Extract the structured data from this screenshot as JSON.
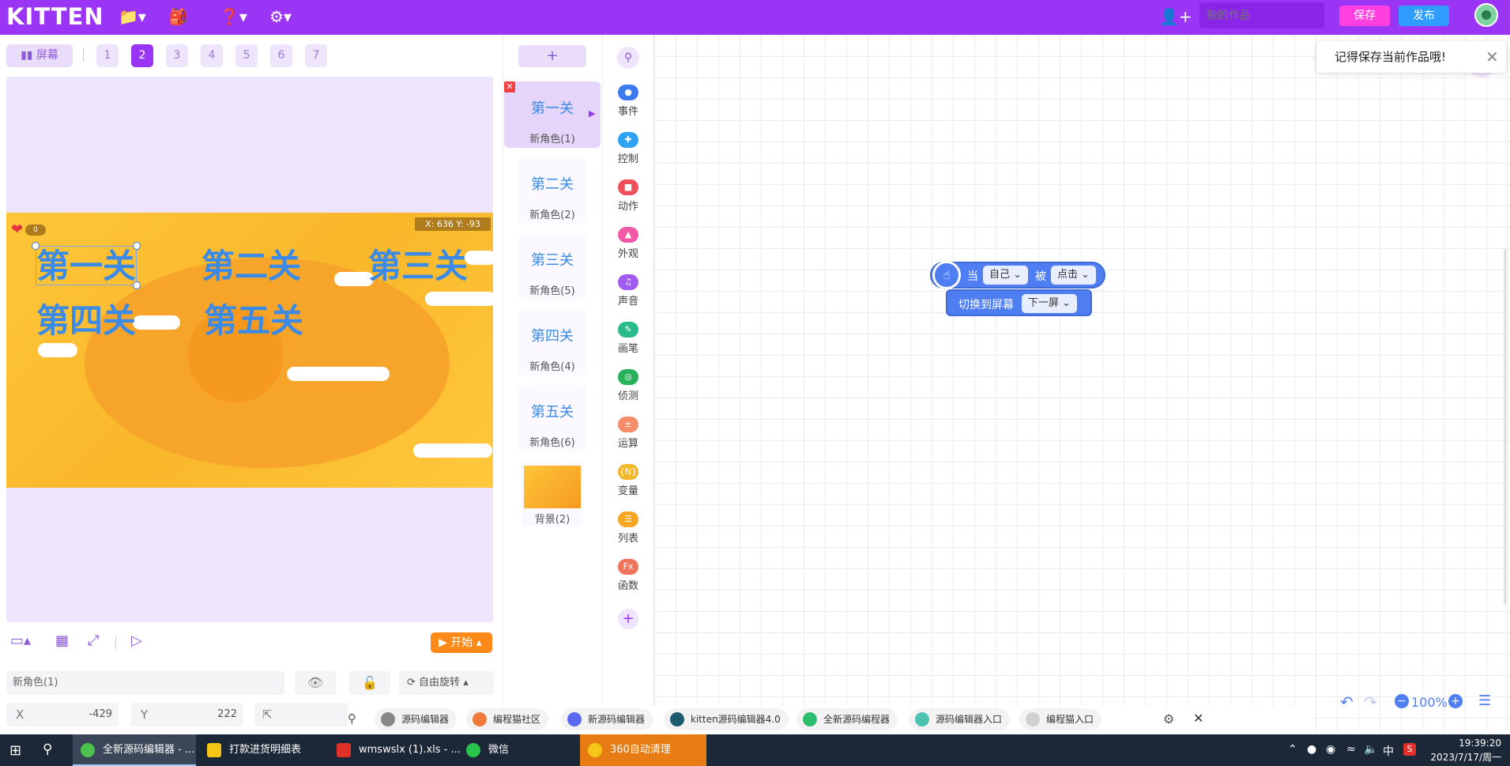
{
  "app": {
    "logo": "KITTEN",
    "project_name_placeholder": "新的作品",
    "save": "保存",
    "publish": "发布",
    "brand_color": "#9a35f5"
  },
  "screens": {
    "screen_label": "屏幕",
    "tabs": [
      "1",
      "2",
      "3",
      "4",
      "5",
      "6",
      "7"
    ],
    "active_tab": "2"
  },
  "stage": {
    "coords": "X: 636   Y: -93",
    "heart_count": "0",
    "level_labels": [
      "第一关",
      "第二关",
      "第三关",
      "第四关",
      "第五关"
    ],
    "start": "开始"
  },
  "sprite_props": {
    "name": "新角色(1)",
    "rotation": "自由旋转",
    "x_label": "X",
    "x_value": "-429",
    "y_label": "Y",
    "y_value": "222"
  },
  "sprites": [
    {
      "title": "第一关",
      "sub": "新角色(1)",
      "active": true
    },
    {
      "title": "第二关",
      "sub": "新角色(2)"
    },
    {
      "title": "第三关",
      "sub": "新角色(5)"
    },
    {
      "title": "第四关",
      "sub": "新角色(4)"
    },
    {
      "title": "第五关",
      "sub": "新角色(6)"
    }
  ],
  "background": {
    "label": "背景(2)"
  },
  "categories": [
    {
      "label": "事件",
      "color": "#3d7af2"
    },
    {
      "label": "控制",
      "color": "#2ea3f5"
    },
    {
      "label": "动作",
      "color": "#f04f5a"
    },
    {
      "label": "外观",
      "color": "#f25aa8"
    },
    {
      "label": "声音",
      "color": "#a25af0"
    },
    {
      "label": "画笔",
      "color": "#29b98b"
    },
    {
      "label": "侦测",
      "color": "#27b15a"
    },
    {
      "label": "运算",
      "color": "#f58d6a"
    },
    {
      "label": "变量",
      "color": "#f5b72a"
    },
    {
      "label": "列表",
      "color": "#f5a623"
    },
    {
      "label": "函数",
      "color": "#f0735a"
    }
  ],
  "workspace": {
    "toast": "记得保存当前作品哦!",
    "hat_block": {
      "when": "当",
      "target": "自己",
      "by": "被",
      "event": "点击"
    },
    "command_block": {
      "text": "切换到屏幕",
      "option": "下一屏"
    },
    "zoom": "100%"
  },
  "web_tabs": [
    {
      "label": "源码编辑器",
      "color": "#888"
    },
    {
      "label": "编程猫社区",
      "color": "#f07a3a"
    },
    {
      "label": "新源码编辑器",
      "color": "#5a6af0"
    },
    {
      "label": "kitten源码编辑器4.0",
      "color": "#1e5a6e"
    },
    {
      "label": "全新源码编程器",
      "color": "#2ebd6f"
    },
    {
      "label": "源码编辑器入口",
      "color": "#4cc2b0"
    },
    {
      "label": "编程猫入口",
      "color": "#d0d0d0"
    }
  ],
  "taskbar": {
    "items": [
      {
        "label": "全新源码编辑器 - ...",
        "color": "#4cc24c",
        "active": true
      },
      {
        "label": "打款进货明细表",
        "color": "#f5c518"
      },
      {
        "label": "wmswslx (1).xls - ...",
        "color": "#e0302a"
      },
      {
        "label": "微信",
        "color": "#2bc24c"
      },
      {
        "label": "360自动清理",
        "color": "#f5c518",
        "orange": true
      }
    ],
    "ime": "中",
    "time": "19:39:20",
    "date": "2023/7/17/周一"
  }
}
